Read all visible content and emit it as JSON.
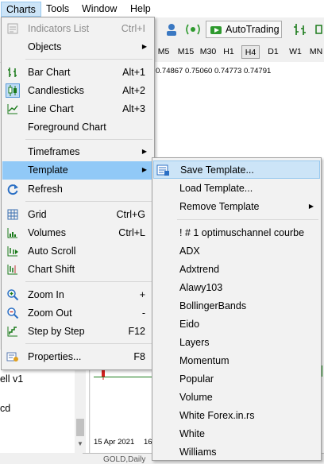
{
  "menubar": {
    "items": [
      "Charts",
      "Tools",
      "Window",
      "Help"
    ]
  },
  "toolbar": {
    "autotrading_label": "AutoTrading"
  },
  "timeframes": [
    "M5",
    "M15",
    "M30",
    "H1",
    "H4",
    "D1",
    "W1",
    "MN"
  ],
  "timeframe_selected": "H4",
  "quote_text": "0.74867 0.75060 0.74773 0.74791",
  "chart": {
    "date_labels": [
      "15 Apr 2021",
      "16"
    ],
    "tab_label": "GOLD,Daily"
  },
  "navigator": {
    "lines": [
      "ell v1",
      "cd"
    ]
  },
  "charts_menu": [
    {
      "label": "Indicators List",
      "shortcut": "Ctrl+I",
      "icon": "indicators-list-icon",
      "disabled": true
    },
    {
      "label": "Objects",
      "submenu": true
    },
    {
      "label": "Bar Chart",
      "shortcut": "Alt+1",
      "icon": "bar-chart-icon"
    },
    {
      "label": "Candlesticks",
      "shortcut": "Alt+2",
      "icon": "candlesticks-icon",
      "checked": true
    },
    {
      "label": "Line Chart",
      "shortcut": "Alt+3",
      "icon": "line-chart-icon"
    },
    {
      "label": "Foreground Chart"
    },
    {
      "label": "Timeframes",
      "submenu": true
    },
    {
      "label": "Template",
      "submenu": true,
      "highlighted": true
    },
    {
      "label": "Refresh",
      "icon": "refresh-icon"
    },
    {
      "label": "Grid",
      "shortcut": "Ctrl+G",
      "icon": "grid-icon"
    },
    {
      "label": "Volumes",
      "shortcut": "Ctrl+L",
      "icon": "volumes-icon"
    },
    {
      "label": "Auto Scroll",
      "icon": "auto-scroll-icon"
    },
    {
      "label": "Chart Shift",
      "icon": "chart-shift-icon"
    },
    {
      "label": "Zoom In",
      "shortcut": "+",
      "icon": "zoom-in-icon"
    },
    {
      "label": "Zoom Out",
      "shortcut": "-",
      "icon": "zoom-out-icon"
    },
    {
      "label": "Step by Step",
      "shortcut": "F12",
      "icon": "step-by-step-icon"
    },
    {
      "label": "Properties...",
      "shortcut": "F8",
      "icon": "properties-icon"
    }
  ],
  "template_menu": [
    {
      "label": "Save Template...",
      "icon": "save-template-icon",
      "highlighted": true
    },
    {
      "label": "Load Template..."
    },
    {
      "label": "Remove Template",
      "submenu": true
    },
    {
      "label": "! # 1 optimuschannel courbe"
    },
    {
      "label": "ADX"
    },
    {
      "label": "Adxtrend"
    },
    {
      "label": "Alawy103"
    },
    {
      "label": "BollingerBands"
    },
    {
      "label": "Eido"
    },
    {
      "label": "Layers"
    },
    {
      "label": "Momentum"
    },
    {
      "label": "Popular"
    },
    {
      "label": "Volume"
    },
    {
      "label": "White Forex.in.rs"
    },
    {
      "label": "White"
    },
    {
      "label": "Williams"
    }
  ],
  "colors": {
    "highlight": "#91c9f7",
    "submenu_highlight": "#cce4f7",
    "menu_bg": "#f2f2f2",
    "candle_red": "#d42020",
    "candle_green": "#1a9a1a"
  }
}
